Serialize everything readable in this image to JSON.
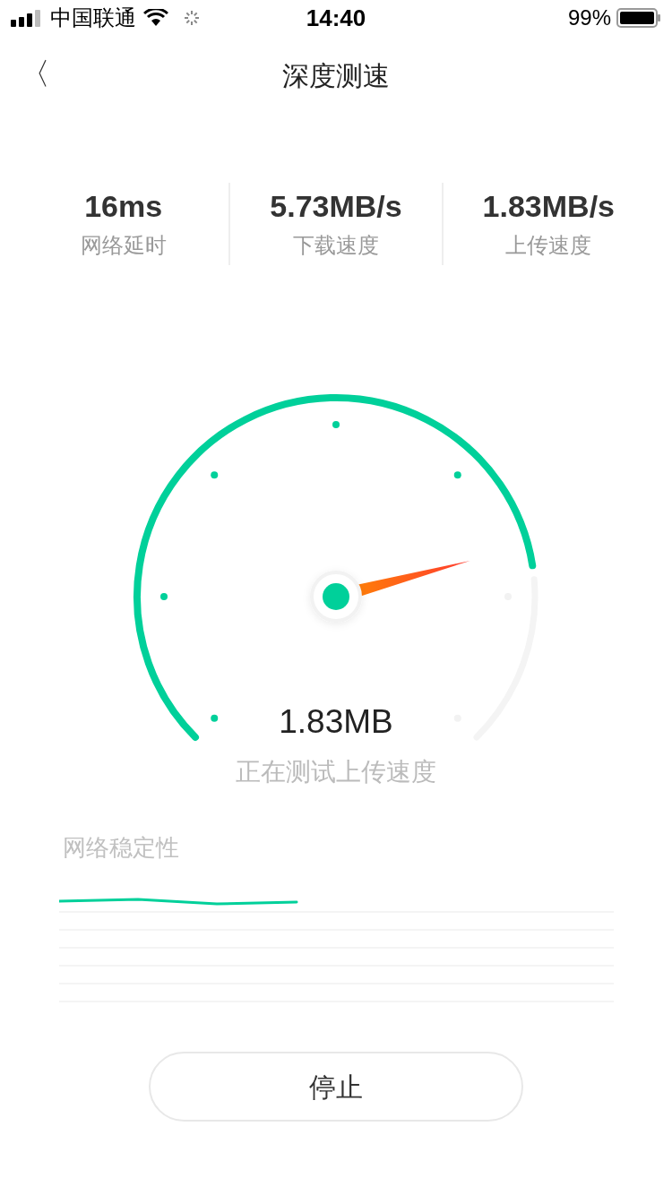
{
  "status_bar": {
    "carrier": "中国联通",
    "time": "14:40",
    "battery": "99%"
  },
  "nav": {
    "back": "〈",
    "title": "深度测速"
  },
  "stats": [
    {
      "value": "16ms",
      "label": "网络延时"
    },
    {
      "value": "5.73MB/s",
      "label": "下载速度"
    },
    {
      "value": "1.83MB/s",
      "label": "上传速度"
    }
  ],
  "gauge": {
    "reading": "1.83MB",
    "caption": "正在测试上传速度"
  },
  "stability": {
    "title": "网络稳定性"
  },
  "buttons": [
    {
      "label": "停止"
    }
  ]
}
